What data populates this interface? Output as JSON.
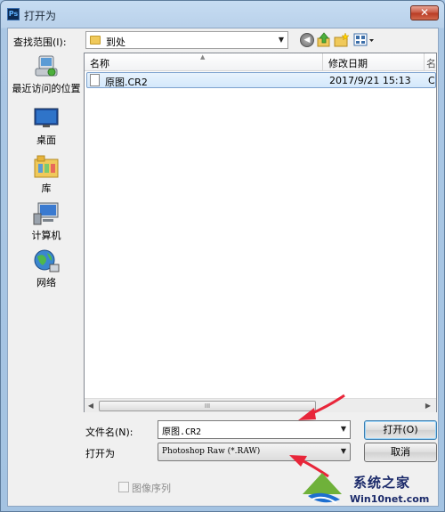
{
  "window": {
    "title": "打开为",
    "app_icon": "Ps",
    "close_glyph": "✕"
  },
  "toolbar": {
    "lookin_label": "查找范围(I):",
    "lookin_value": "到处",
    "back_glyph": "◀"
  },
  "places": [
    {
      "label": "最近访问的位置",
      "icon": "recent-places-icon"
    },
    {
      "label": "桌面",
      "icon": "desktop-icon"
    },
    {
      "label": "库",
      "icon": "library-icon"
    },
    {
      "label": "计算机",
      "icon": "computer-icon"
    },
    {
      "label": "网络",
      "icon": "network-icon"
    }
  ],
  "filelist": {
    "col_name": "名称",
    "col_date": "修改日期",
    "col_extra": "名",
    "rows": [
      {
        "name": "原图.CR2",
        "date": "2017/9/21 15:13",
        "extra": "C"
      }
    ],
    "scroll_grip": "III"
  },
  "form": {
    "filename_label": "文件名(N):",
    "filename_value": "原图.CR2",
    "type_label": "打开为",
    "type_value": "Photoshop Raw (*.RAW)",
    "open_label": "打开(O)",
    "cancel_label": "取消",
    "sequence_label": "图像序列"
  },
  "watermark": {
    "text": "系统之家",
    "url": "Win10net.com"
  },
  "colors": {
    "arrow": "#e8263a",
    "selection": "#d4e8fb",
    "accent": "#3c7fb1"
  }
}
